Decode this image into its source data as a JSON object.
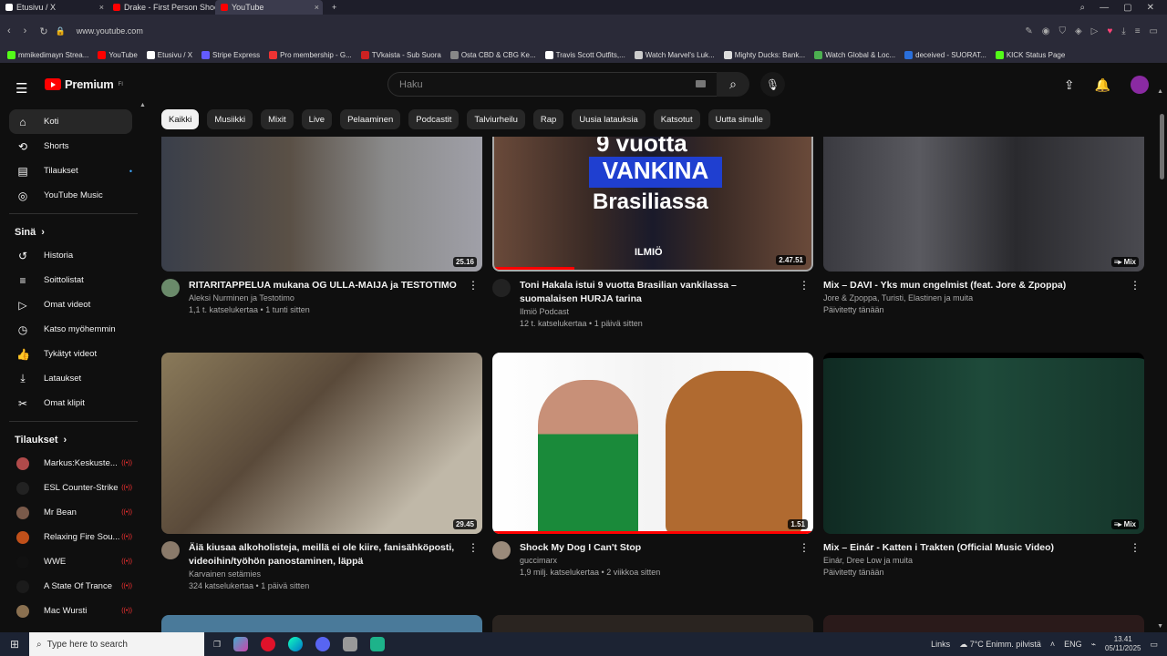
{
  "browser": {
    "tabs": [
      {
        "label": "Etusivu / X",
        "color": "#ffffff"
      },
      {
        "label": "Drake - First Person Shoot",
        "color": "#ff0000"
      },
      {
        "label": "YouTube",
        "color": "#ff0000"
      }
    ],
    "url": "www.youtube.com",
    "bookmarks": [
      {
        "label": "mmikedimayn Strea...",
        "color": "#53fc18"
      },
      {
        "label": "YouTube",
        "color": "#ff0000"
      },
      {
        "label": "Etusivu / X",
        "color": "#ffffff"
      },
      {
        "label": "Stripe Express",
        "color": "#635bff"
      },
      {
        "label": "Pro membership - G...",
        "color": "#e33"
      },
      {
        "label": "TVkaista - Sub Suora",
        "color": "#c22"
      },
      {
        "label": "Osta CBD & CBG Ke...",
        "color": "#888"
      },
      {
        "label": "Travis Scott Outfits,...",
        "color": "#fff"
      },
      {
        "label": "Watch Marvel's Luk...",
        "color": "#ccc"
      },
      {
        "label": "Mighty Ducks: Bank...",
        "color": "#ddd"
      },
      {
        "label": "Watch Global & Loc...",
        "color": "#4caf50"
      },
      {
        "label": "deceived - SUORAT...",
        "color": "#2a6fdb"
      },
      {
        "label": "KICK Status Page",
        "color": "#53fc18"
      }
    ]
  },
  "header": {
    "logo_text": "Premium",
    "logo_region": "FI",
    "search_placeholder": "Haku"
  },
  "sidebar": {
    "main": [
      {
        "label": "Koti",
        "icon": "⌂"
      },
      {
        "label": "Shorts",
        "icon": "⟲"
      },
      {
        "label": "Tilaukset",
        "icon": "▤"
      },
      {
        "label": "YouTube Music",
        "icon": "◎"
      }
    ],
    "you_heading": "Sinä",
    "you": [
      {
        "label": "Historia",
        "icon": "↺"
      },
      {
        "label": "Soittolistat",
        "icon": "≡"
      },
      {
        "label": "Omat videot",
        "icon": "▷"
      },
      {
        "label": "Katso myöhemmin",
        "icon": "◷"
      },
      {
        "label": "Tykätyt videot",
        "icon": "👍"
      },
      {
        "label": "Lataukset",
        "icon": "⤓"
      },
      {
        "label": "Omat klipit",
        "icon": "✂"
      }
    ],
    "subs_heading": "Tilaukset",
    "subs": [
      {
        "label": "Markus:Keskuste...",
        "color": "#b04a4a"
      },
      {
        "label": "ESL Counter-Strike",
        "color": "#222222"
      },
      {
        "label": "Mr Bean",
        "color": "#7a5a4a"
      },
      {
        "label": "Relaxing Fire Sou...",
        "color": "#c0501a"
      },
      {
        "label": "WWE",
        "color": "#111111"
      },
      {
        "label": "A State Of Trance",
        "color": "#1b1b1b"
      },
      {
        "label": "Mac Wursti",
        "color": "#8a7050"
      }
    ]
  },
  "chips": [
    "Kaikki",
    "Musiikki",
    "Mixit",
    "Live",
    "Pelaaminen",
    "Podcastit",
    "Talviurheilu",
    "Rap",
    "Uusia latauksia",
    "Katsotut",
    "Uutta sinulle"
  ],
  "videos": [
    {
      "title": "RITARITAPPELUA mukana OG ULLA-MAIJA ja TESTOTIMO",
      "channel": "Aleksi Nurminen ja Testotimo",
      "stats": "1,1 t. katselukertaa • 1 tunti sitten",
      "duration": "25.16",
      "thumb_color": "#4a4a48",
      "avatar_color": "#6a8a6a"
    },
    {
      "title": "Toni Hakala istui 9 vuotta Brasilian vankilassa – suomalaisen HURJA tarina",
      "channel": "Ilmiö Podcast",
      "stats": "12 t. katselukertaa • 1 päivä sitten",
      "duration": "2.47.51",
      "thumb_color": "#2a2a2a",
      "avatar_color": "#222222",
      "thumb_line1": "9 vuotta",
      "thumb_line2": "VANKINA",
      "thumb_line3": "Brasiliassa",
      "thumb_brand": "ILMIÖ"
    },
    {
      "title": "Mix – DAVI - Yks mun cngelmist (feat. Jore & Zpoppa)",
      "channel": "Jore & Zpoppa, Turisti, Elastinen ja muita",
      "stats": "Päivitetty tänään",
      "duration": "Mix",
      "thumb_color": "#3a3a3e",
      "avatar_color": ""
    },
    {
      "title": "Äiä kiusaa alkoholisteja, meillä ei ole kiire, fanisähköposti, videoihin/työhön panostaminen, läppä",
      "channel": "Karvainen setämies",
      "stats": "324 katselukertaa • 1 päivä sitten",
      "duration": "29.45",
      "thumb_color": "#6a5a48",
      "avatar_color": "#8a7a6a"
    },
    {
      "title": "Shock My Dog I Can't Stop",
      "channel": "guccimarx",
      "stats": "1,9 milj. katselukertaa • 2 viikkoa sitten",
      "duration": "1.51",
      "thumb_color": "#f0f0f0",
      "avatar_color": "#9a8a7a"
    },
    {
      "title": "Mix – Einár - Katten i Trakten (Official Music Video)",
      "channel": "Einár, Dree Low ja muita",
      "stats": "Päivitetty tänään",
      "duration": "Mix",
      "thumb_color": "#1e3a30",
      "avatar_color": ""
    }
  ],
  "taskbar": {
    "search_placeholder": "Type here to search",
    "links": "Links",
    "weather": "7°C  Enimm. pilvistä",
    "lang": "ENG",
    "time": "13.41",
    "date": "05/11/2025"
  }
}
